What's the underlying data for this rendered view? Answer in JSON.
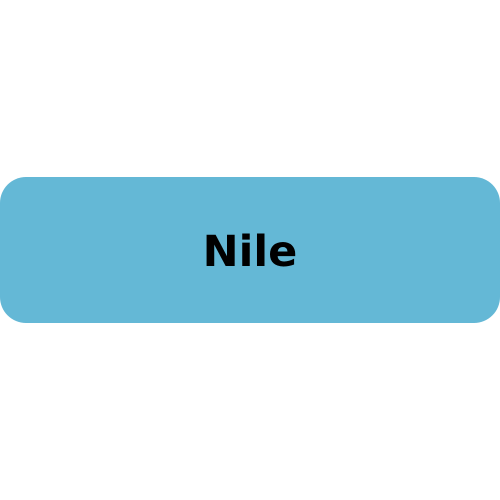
{
  "option": {
    "label": "Nile",
    "background_color": "#64b8d6",
    "text_color": "#000000"
  }
}
